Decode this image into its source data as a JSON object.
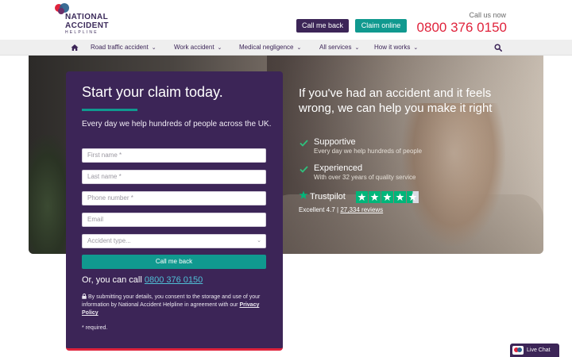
{
  "brand": {
    "line1": "NATIONAL",
    "line2": "ACCIDENT",
    "line3": "HELPLINE",
    "colors": {
      "primary": "#3c2557",
      "accent": "#e0233c",
      "teal": "#10998f"
    }
  },
  "header": {
    "call_me_back": "Call me back",
    "claim_online": "Claim online",
    "call_us_now": "Call us now",
    "phone": "0800 376 0150"
  },
  "nav": {
    "home_icon": "home-icon",
    "items": [
      {
        "label": "Road traffic accident"
      },
      {
        "label": "Work accident"
      },
      {
        "label": "Medical negligence"
      },
      {
        "label": "All services"
      },
      {
        "label": "How it works"
      }
    ],
    "chevron": "⌄",
    "search_icon": "search-icon"
  },
  "hero": {
    "headline": "If you've had an accident and it feels wrong, we can help you make it right",
    "features": [
      {
        "title": "Supportive",
        "subtitle": "Every day we help hundreds of people"
      },
      {
        "title": "Experienced",
        "subtitle": "With over 32 years of quality service"
      }
    ],
    "trustpilot": {
      "name": "Trustpilot",
      "rating_label": "Excellent 4.7",
      "separator": "|",
      "reviews": "27,334 reviews",
      "stars": 4.5
    }
  },
  "form": {
    "title": "Start your claim today.",
    "intro": "Every day we help hundreds of people across the UK.",
    "fields": {
      "first_name": "First name *",
      "last_name": "Last name *",
      "phone": "Phone number *",
      "email": "Email",
      "accident_type": "Accident type..."
    },
    "submit": "Call me back",
    "or_call_prefix": "Or, you can call ",
    "or_call_number": "0800 376 0150",
    "consent_text": "By submitting your details, you consent to the storage and use of your information by National Accident Helpline in agreement with our ",
    "privacy_link": "Privacy Policy",
    "required_note": "* required."
  },
  "live_chat": {
    "label": "Live Chat"
  }
}
